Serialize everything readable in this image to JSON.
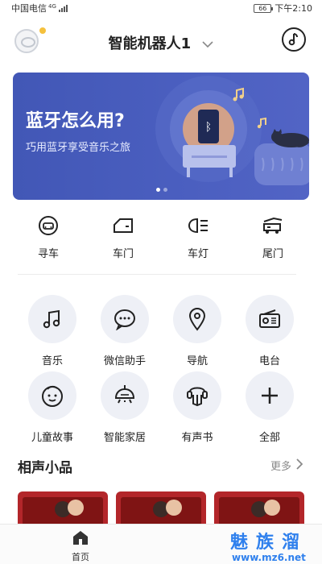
{
  "status_bar": {
    "carrier": "中国电信",
    "network": "4G",
    "battery": "66",
    "time": "下午2:10"
  },
  "header": {
    "device_name": "智能机器人1",
    "chevron_icon": "chevron-down-icon",
    "music_icon": "music-note-icon"
  },
  "banner": {
    "title": "蓝牙怎么用?",
    "subtitle": "巧用蓝牙享受音乐之旅"
  },
  "quick_actions": [
    {
      "label": "寻车",
      "icon": "car-front-icon"
    },
    {
      "label": "车门",
      "icon": "car-door-icon"
    },
    {
      "label": "车灯",
      "icon": "headlight-icon"
    },
    {
      "label": "尾门",
      "icon": "trunk-icon"
    }
  ],
  "features": [
    {
      "label": "音乐",
      "icon": "music-icon"
    },
    {
      "label": "微信助手",
      "icon": "chat-bubble-icon"
    },
    {
      "label": "导航",
      "icon": "location-pin-icon"
    },
    {
      "label": "电台",
      "icon": "radio-icon"
    },
    {
      "label": "儿童故事",
      "icon": "child-face-icon"
    },
    {
      "label": "智能家居",
      "icon": "ceiling-lamp-icon"
    },
    {
      "label": "有声书",
      "icon": "audiobook-icon"
    },
    {
      "label": "全部",
      "icon": "plus-icon"
    }
  ],
  "section": {
    "title": "相声小品",
    "more": "更多"
  },
  "bottom_nav": {
    "home_label": "首页"
  },
  "watermark": {
    "main": "魅族溜",
    "url": "www.mz6.net"
  },
  "colors": {
    "banner": "#4257b6",
    "feature_circle": "#eef0f6",
    "card_red": "#b3262a",
    "watermark": "#2f80ed",
    "avatar_dot": "#f5c13d"
  }
}
